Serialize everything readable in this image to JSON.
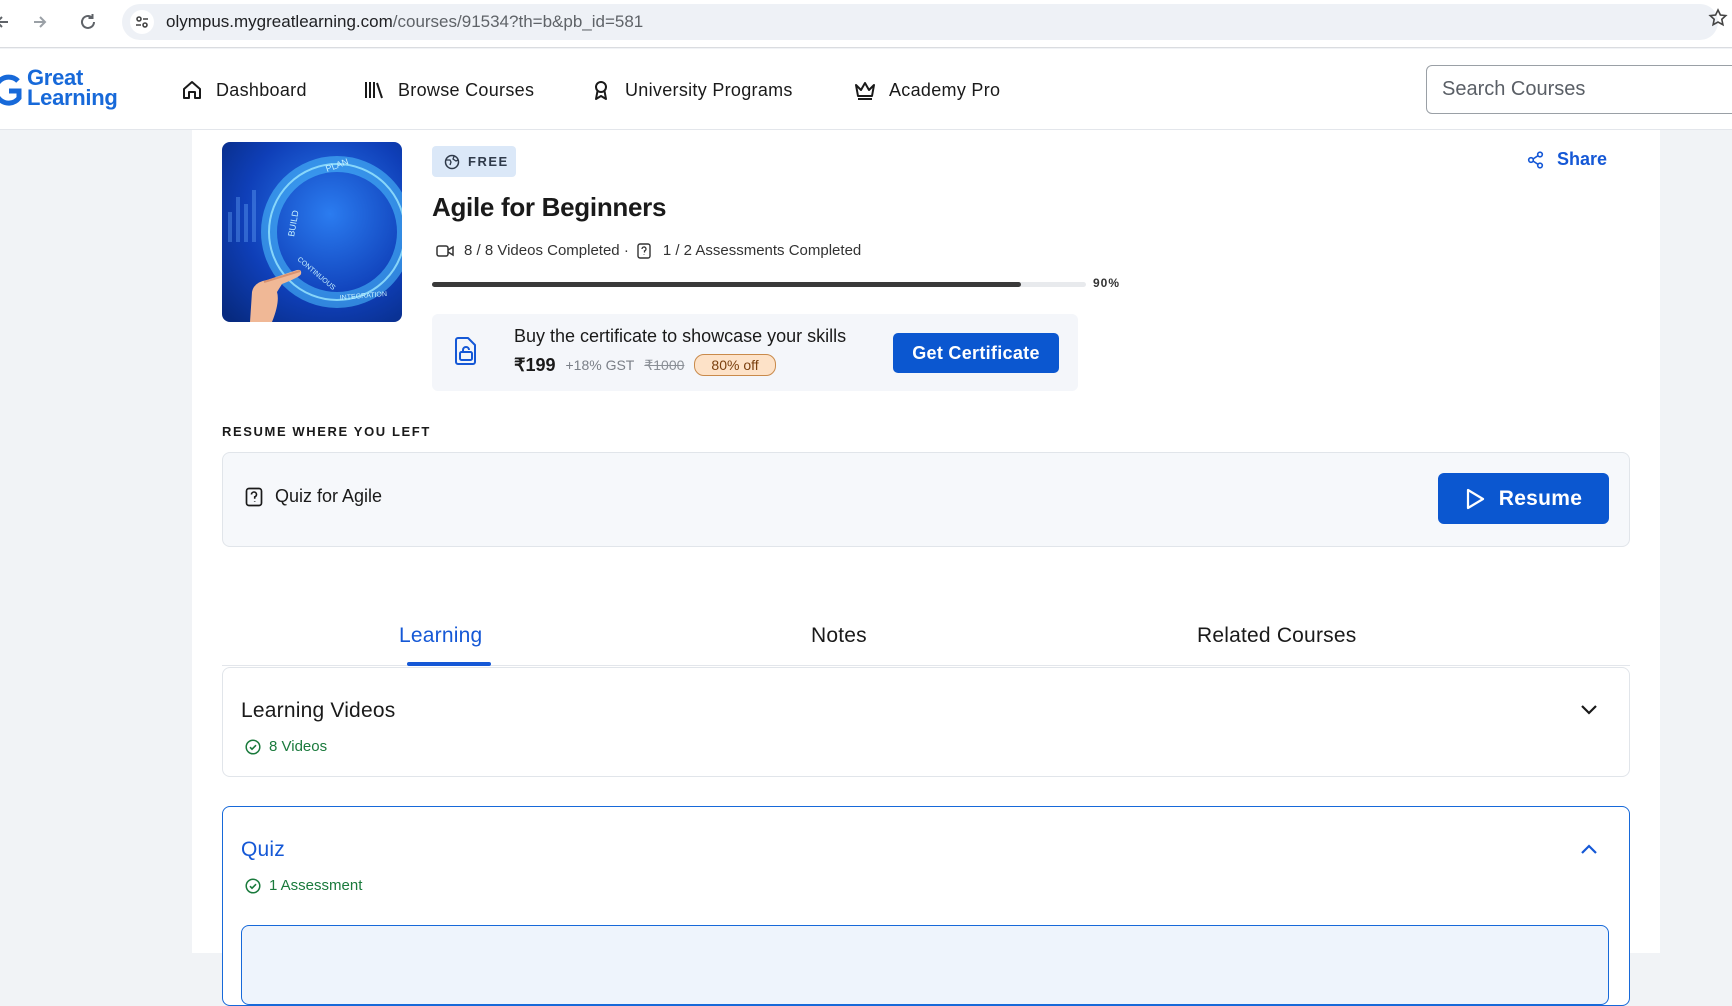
{
  "browser": {
    "url_host": "olympus.mygreatlearning.com",
    "url_path": "/courses/91534?th=b&pb_id=581"
  },
  "header": {
    "logo_line1": "Great",
    "logo_line2": "Learning",
    "nav": [
      {
        "label": "Dashboard",
        "icon": "home-icon"
      },
      {
        "label": "Browse Courses",
        "icon": "library-icon"
      },
      {
        "label": "University Programs",
        "icon": "award-icon"
      },
      {
        "label": "Academy Pro",
        "icon": "crown-icon"
      }
    ],
    "search_placeholder": "Search Courses"
  },
  "course": {
    "badge": "FREE",
    "title": "Agile for Beginners",
    "share_label": "Share",
    "videos_completed": "8 / 8 Videos Completed ·",
    "assessments_completed": "1 / 2 Assessments Completed",
    "progress_percent": 90,
    "progress_label": "90%",
    "thumbnail_words": [
      "PLAN",
      "BUILD",
      "CONTINUOUS",
      "INTEGRATION"
    ]
  },
  "certificate": {
    "text": "Buy the certificate to showcase your skills",
    "price": "₹199",
    "gst": "+18% GST",
    "original_price": "₹1000",
    "discount": "80% off",
    "button_label": "Get Certificate"
  },
  "resume": {
    "heading": "RESUME WHERE YOU LEFT",
    "item_label": "Quiz for Agile",
    "button_label": "Resume"
  },
  "tabs": [
    "Learning",
    "Notes",
    "Related Courses"
  ],
  "sections": {
    "videos": {
      "title": "Learning Videos",
      "subtitle": "8 Videos"
    },
    "quiz": {
      "title": "Quiz",
      "subtitle": "1 Assessment"
    }
  },
  "colors": {
    "accent": "#0b57d0",
    "link": "#1558d6",
    "success": "#1a7a3c",
    "discount_bg": "#fde2c8"
  }
}
